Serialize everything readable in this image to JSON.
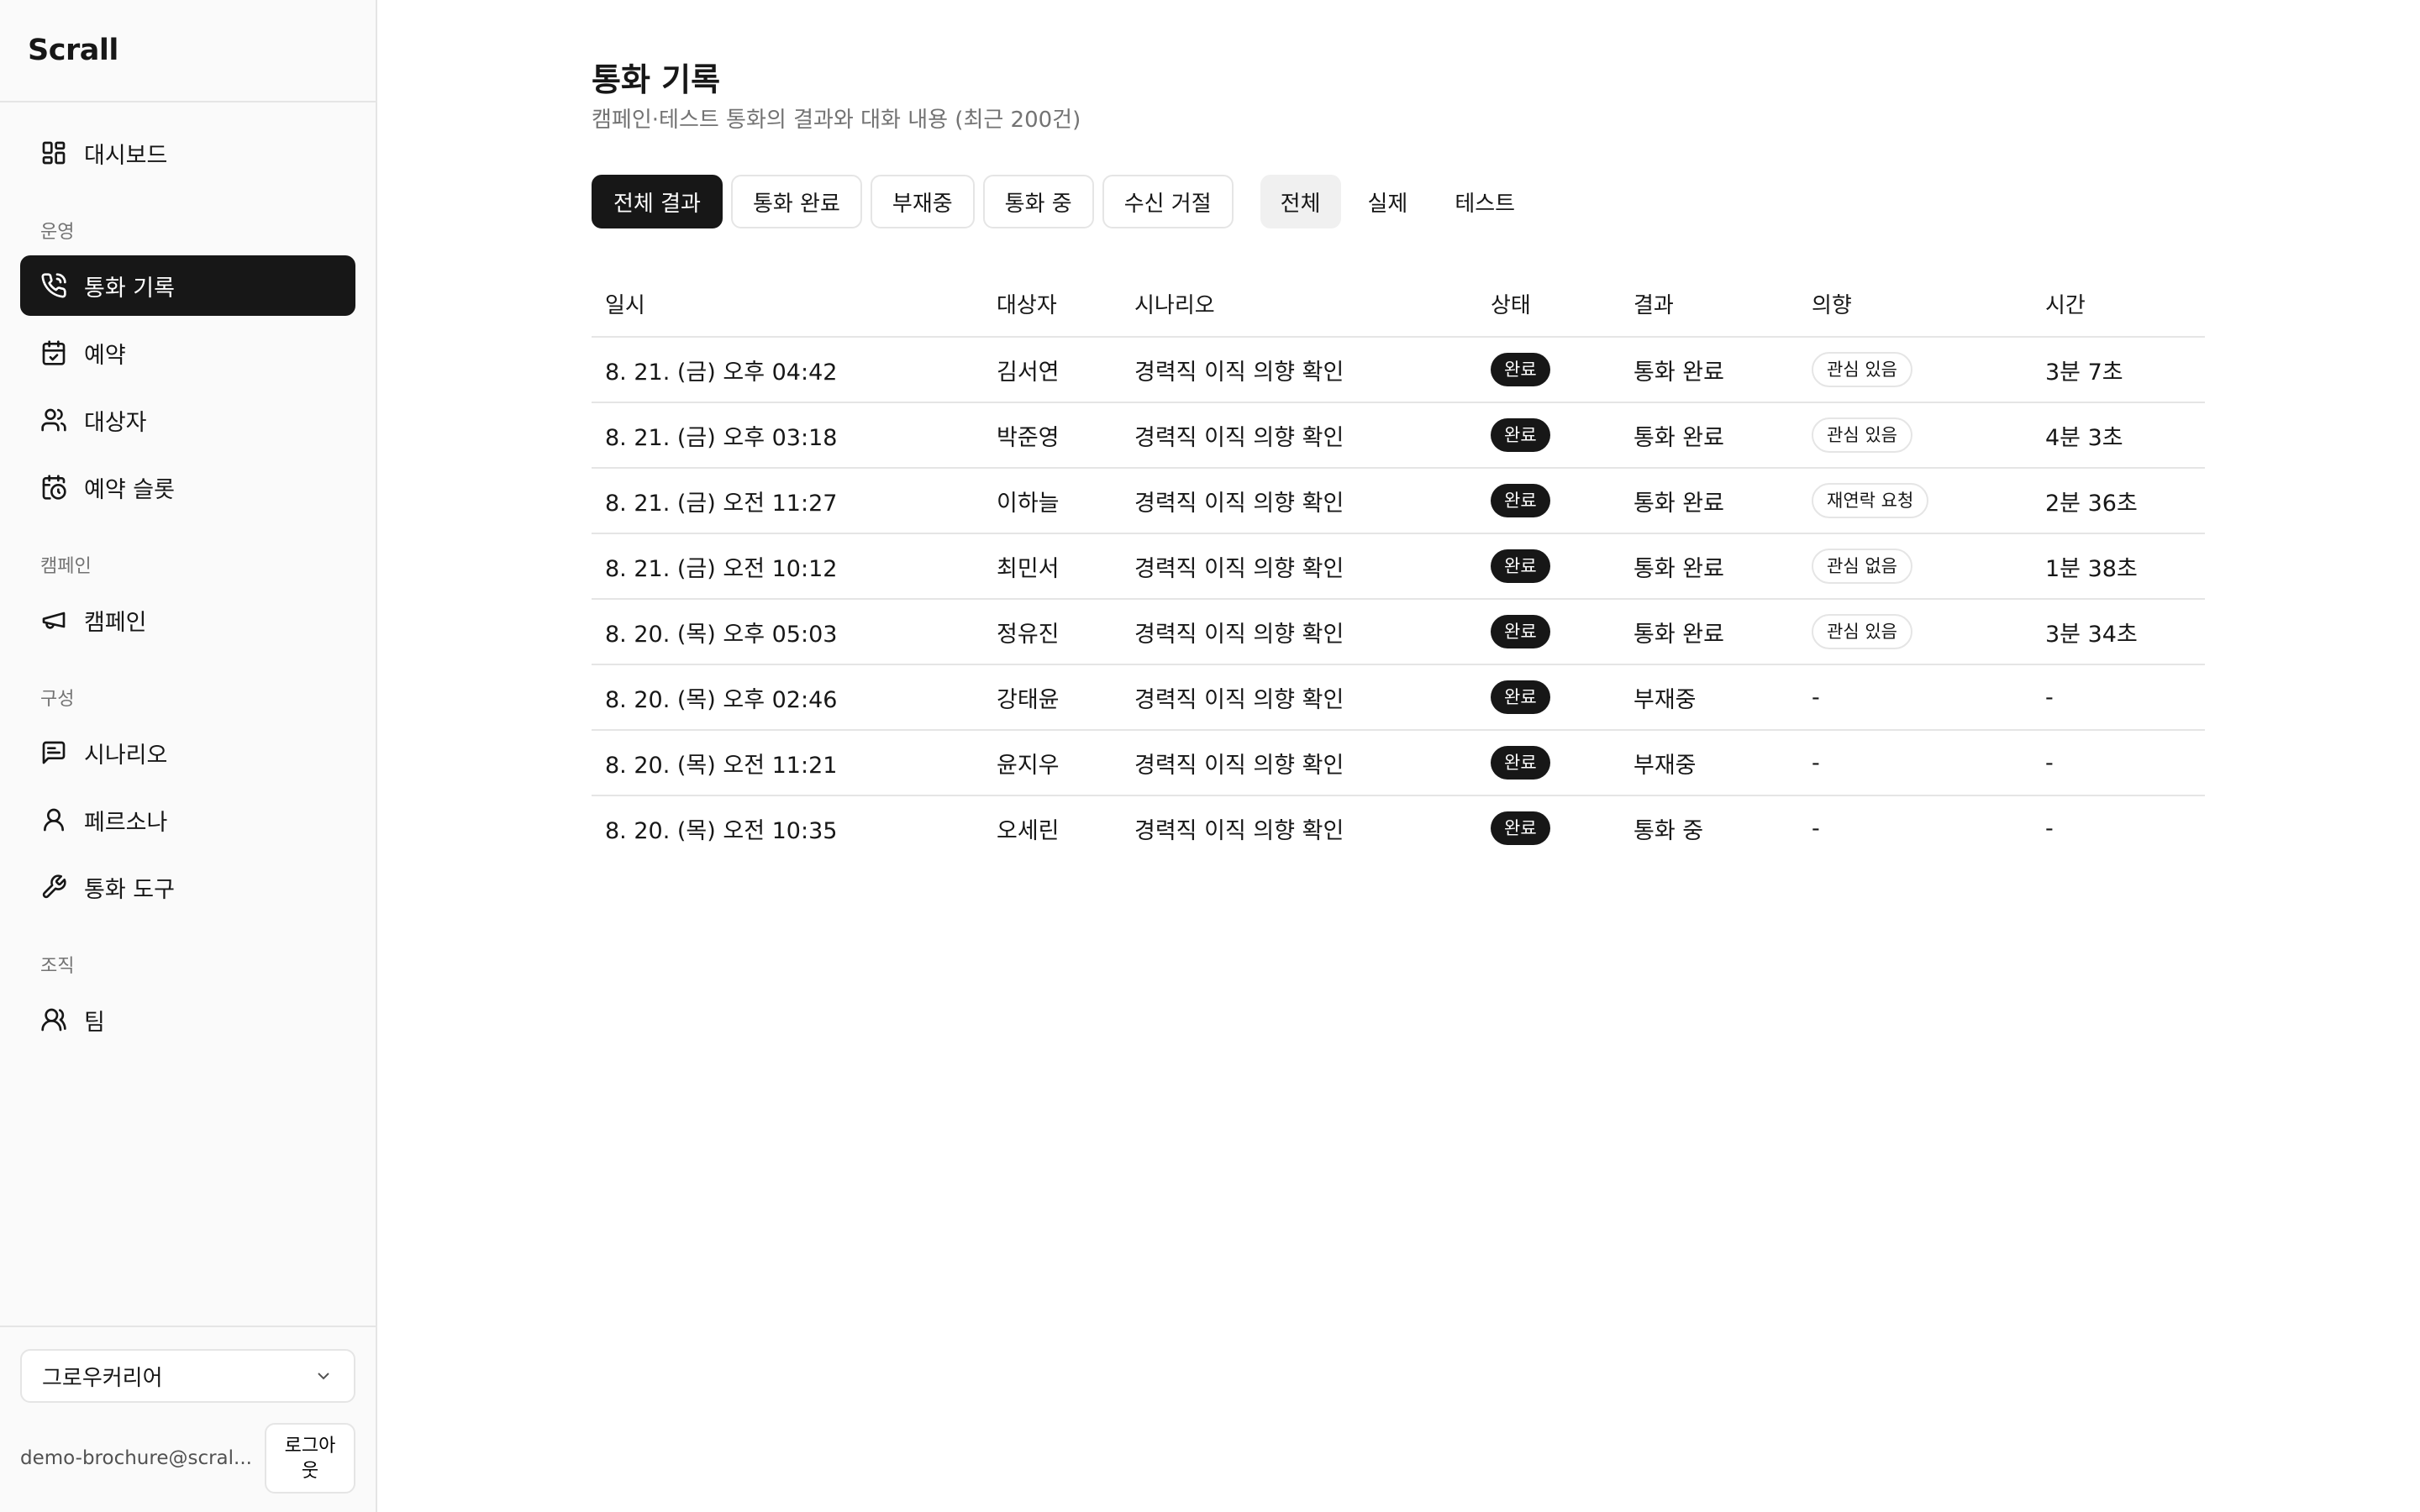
{
  "app": {
    "brand": "Scrall"
  },
  "sidebar": {
    "dashboard": "대시보드",
    "sections": {
      "operations": "운영",
      "campaign": "캠페인",
      "config": "구성",
      "org": "조직"
    },
    "items": {
      "calls": "통화 기록",
      "reservations": "예약",
      "targets": "대상자",
      "slots": "예약 슬롯",
      "campaigns": "캠페인",
      "scenarios": "시나리오",
      "personas": "페르소나",
      "tools": "통화 도구",
      "team": "팀"
    },
    "org_select": "그로우커리어",
    "user_email": "demo-brochure@scral...",
    "logout": "로그아웃"
  },
  "page": {
    "title": "통화 기록",
    "subtitle": "캠페인·테스트 통화의 결과와 대화 내용 (최근 200건)"
  },
  "filters": {
    "results": [
      "전체 결과",
      "통화 완료",
      "부재중",
      "통화 중",
      "수신 거절"
    ],
    "types": [
      "전체",
      "실제",
      "테스트"
    ]
  },
  "table": {
    "headers": [
      "일시",
      "대상자",
      "시나리오",
      "상태",
      "결과",
      "의향",
      "시간"
    ],
    "rows": [
      {
        "datetime": "8. 21. (금) 오후 04:42",
        "target": "김서연",
        "scenario": "경력직 이직 의향 확인",
        "status": "완료",
        "result": "통화 완료",
        "intent": "관심 있음",
        "duration": "3분 7초"
      },
      {
        "datetime": "8. 21. (금) 오후 03:18",
        "target": "박준영",
        "scenario": "경력직 이직 의향 확인",
        "status": "완료",
        "result": "통화 완료",
        "intent": "관심 있음",
        "duration": "4분 3초"
      },
      {
        "datetime": "8. 21. (금) 오전 11:27",
        "target": "이하늘",
        "scenario": "경력직 이직 의향 확인",
        "status": "완료",
        "result": "통화 완료",
        "intent": "재연락 요청",
        "duration": "2분 36초"
      },
      {
        "datetime": "8. 21. (금) 오전 10:12",
        "target": "최민서",
        "scenario": "경력직 이직 의향 확인",
        "status": "완료",
        "result": "통화 완료",
        "intent": "관심 없음",
        "duration": "1분 38초"
      },
      {
        "datetime": "8. 20. (목) 오후 05:03",
        "target": "정유진",
        "scenario": "경력직 이직 의향 확인",
        "status": "완료",
        "result": "통화 완료",
        "intent": "관심 있음",
        "duration": "3분 34초"
      },
      {
        "datetime": "8. 20. (목) 오후 02:46",
        "target": "강태윤",
        "scenario": "경력직 이직 의향 확인",
        "status": "완료",
        "result": "부재중",
        "intent": "-",
        "duration": "-"
      },
      {
        "datetime": "8. 20. (목) 오전 11:21",
        "target": "윤지우",
        "scenario": "경력직 이직 의향 확인",
        "status": "완료",
        "result": "부재중",
        "intent": "-",
        "duration": "-"
      },
      {
        "datetime": "8. 20. (목) 오전 10:35",
        "target": "오세린",
        "scenario": "경력직 이직 의향 확인",
        "status": "완료",
        "result": "통화 중",
        "intent": "-",
        "duration": "-"
      }
    ]
  }
}
